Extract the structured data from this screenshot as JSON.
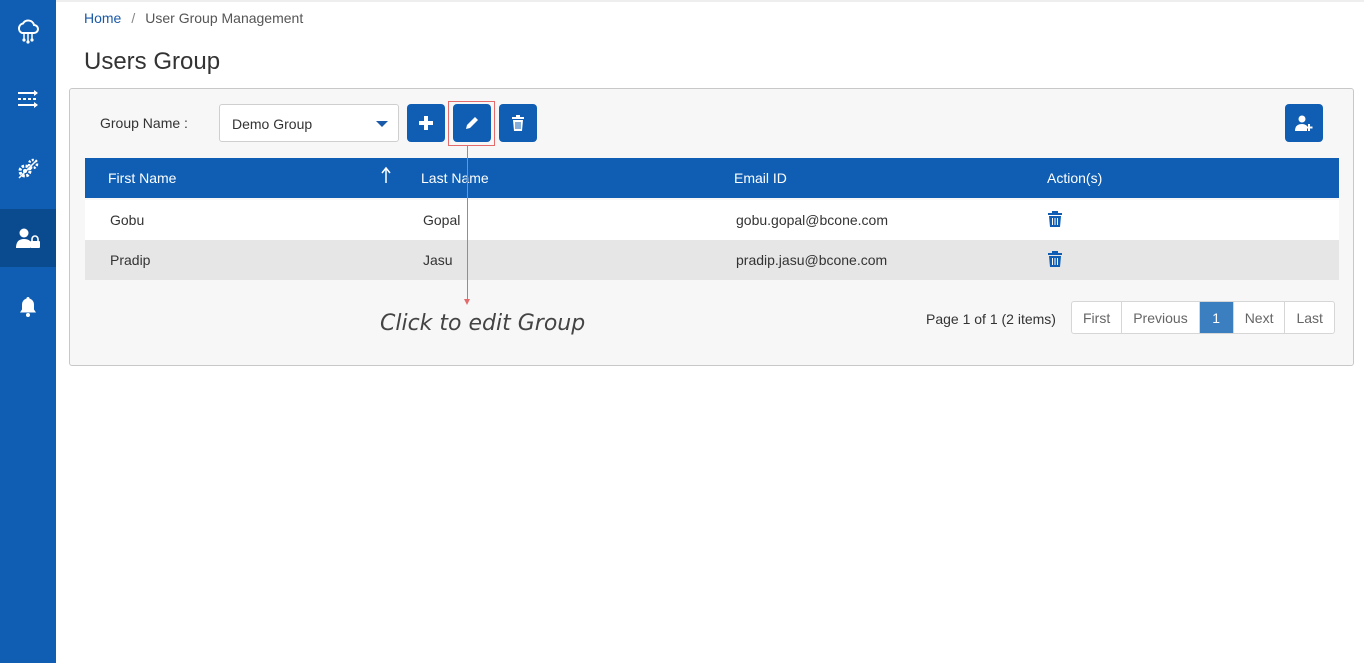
{
  "breadcrumb": {
    "home": "Home",
    "separator": "/",
    "current": "User Group Management"
  },
  "page_title": "Users Group",
  "group": {
    "label": "Group Name :",
    "selected": "Demo Group"
  },
  "table": {
    "columns": [
      "First Name",
      "Last Name",
      "Email ID",
      "Action(s)"
    ],
    "rows": [
      {
        "first": "Gobu",
        "last": "Gopal",
        "email": "gobu.gopal@bcone.com"
      },
      {
        "first": "Pradip",
        "last": "Jasu",
        "email": "pradip.jasu@bcone.com"
      }
    ]
  },
  "annotation": "Click to edit Group",
  "pagination": {
    "info": "Page 1 of 1 (2 items)",
    "first": "First",
    "previous": "Previous",
    "current": "1",
    "next": "Next",
    "last": "Last"
  },
  "colors": {
    "primary": "#0f5eb3",
    "sidebar_active": "#0a4a8f",
    "annotation_red": "#e36b6b",
    "page_active": "#3c7fc0"
  },
  "icons": [
    "cloud-network-icon",
    "shuffle-icon",
    "gears-icon",
    "user-lock-icon",
    "bell-icon",
    "plus-icon",
    "pencil-icon",
    "trash-icon",
    "user-plus-icon",
    "sort-up-icon"
  ]
}
